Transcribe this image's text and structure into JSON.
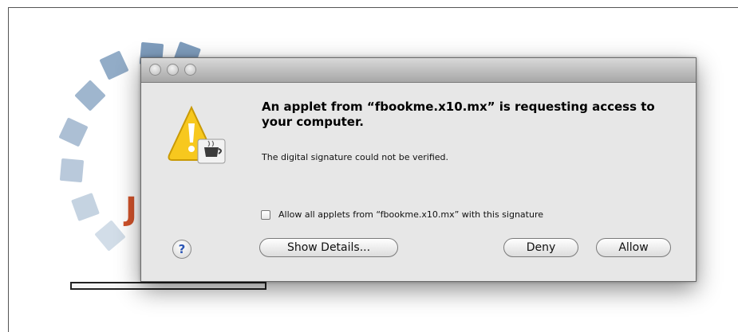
{
  "background": {
    "java_logo_letter": "J",
    "progress": 0.0
  },
  "dialog": {
    "headline": "An applet from “fbookme.x10.mx” is requesting access to your computer.",
    "subtext": "The digital signature could not be verified.",
    "checkbox_label": "Allow all applets from “fbookme.x10.mx” with this signature",
    "checkbox_checked": false,
    "help_glyph": "?",
    "buttons": {
      "show_details": "Show Details...",
      "deny": "Deny",
      "allow": "Allow"
    },
    "icons": {
      "warning": "warning-triangle-icon",
      "java": "java-cup-icon",
      "help": "help-icon"
    }
  },
  "colors": {
    "spinner": "#7f9dbd",
    "warning_yellow": "#f7c81e",
    "help_blue": "#2a55b5"
  }
}
